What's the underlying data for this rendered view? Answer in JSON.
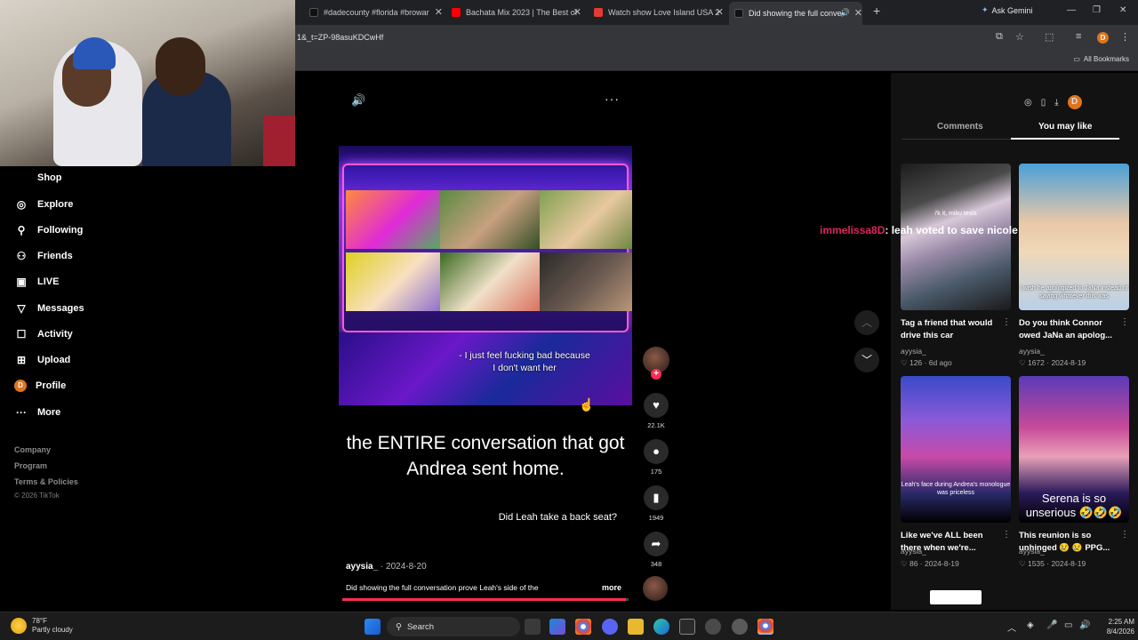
{
  "browser": {
    "tabs": [
      {
        "title": "#dadecounty #florida #browar",
        "favicon_color": "#111111"
      },
      {
        "title": "Bachata Mix 2023 | The Best of",
        "favicon_color": "#ff0000"
      },
      {
        "title": "Watch show Love Island USA 2",
        "favicon_color": "#e53935"
      },
      {
        "title": "Did showing the full conve",
        "favicon_color": "#111111"
      }
    ],
    "new_tab": "+",
    "ask_gemini": "Ask Gemini",
    "url": "1&_t=ZP-98asuKDCwHf",
    "all_bookmarks": "All Bookmarks",
    "profile_initial": "D"
  },
  "sidebar": {
    "items": [
      {
        "label": "Shop",
        "icon": "shop-icon"
      },
      {
        "label": "Explore",
        "icon": "compass-icon"
      },
      {
        "label": "Following",
        "icon": "following-icon"
      },
      {
        "label": "Friends",
        "icon": "friends-icon"
      },
      {
        "label": "LIVE",
        "icon": "live-icon"
      },
      {
        "label": "Messages",
        "icon": "messages-icon"
      },
      {
        "label": "Activity",
        "icon": "activity-icon"
      },
      {
        "label": "Upload",
        "icon": "upload-icon"
      },
      {
        "label": "Profile",
        "icon": "profile-avatar"
      },
      {
        "label": "More",
        "icon": "more-icon"
      }
    ],
    "profile_initial": "D",
    "footer": [
      "Company",
      "Program",
      "Terms & Policies"
    ],
    "copyright": "© 2026 TikTok"
  },
  "video": {
    "subtitle": "- I just feel fucking bad because I don't want her",
    "caption": "the ENTIRE conversation that got Andrea sent home.",
    "question": "Did Leah take a back seat?",
    "author": "ayysia_",
    "date": "· 2024-8-20",
    "description": "Did showing the full conversation prove Leah's side of the",
    "more": "more",
    "progress": 0.99
  },
  "actions": {
    "likes": "22.1K",
    "comments": "175",
    "saves": "1949",
    "shares": "348"
  },
  "live_comment": {
    "user": "immelissa8D",
    "text": ": leah voted to save nicole"
  },
  "right_panel": {
    "tabs": [
      "Comments",
      "You may like"
    ],
    "active_tab": "You may like",
    "cards": [
      {
        "title": "Tag a friend that would drive this car",
        "author": "ayysia_",
        "stats": "♡ 126 · 6d ago",
        "thumb_caption": "i'k it, miku tesla"
      },
      {
        "title": "Do you think Connor owed JaNa an apolog...",
        "author": "ayysia_",
        "stats": "♡ 1672 · 2024-8-19",
        "thumb_caption": "i wish he apologized to JaNa instead of saying whatever this was"
      },
      {
        "title": "Like we've ALL been there when we're...",
        "author": "ayysia_",
        "stats": "♡ 86 · 2024-8-19",
        "thumb_caption": "Leah's face during Andrea's monologue was priceless"
      },
      {
        "title": "This reunion is so unhinged 😢 😢 PPG...",
        "author": "ayysia_",
        "stats": "♡ 1535 · 2024-8-19",
        "thumb_caption": "Serena is so unserious 🤣🤣🤣"
      }
    ]
  },
  "taskbar": {
    "temp": "78°F",
    "weather": "Partly cloudy",
    "search": "Search",
    "time": "2:25 AM",
    "date": "8/4/2026"
  },
  "colors": {
    "accent": "#fe2c55",
    "live_user": "#e0245e",
    "profile": "#e0741c"
  }
}
